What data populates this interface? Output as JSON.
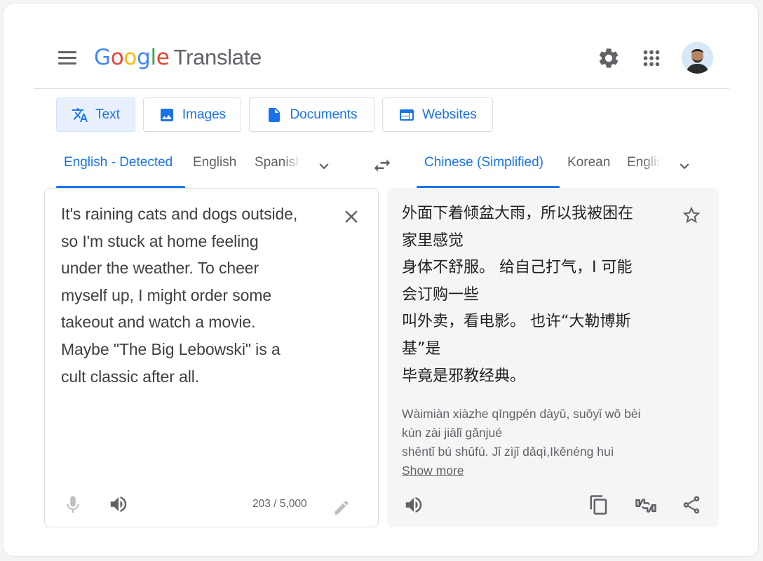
{
  "header": {
    "logo_brand": "Google",
    "logo_product": "Translate",
    "icons": [
      "menu-icon",
      "settings-gear-icon",
      "apps-grid-icon",
      "account-avatar"
    ]
  },
  "mode_tabs": [
    {
      "label": "Text",
      "icon": "translate-icon",
      "active": true
    },
    {
      "label": "Images",
      "icon": "image-icon",
      "active": false
    },
    {
      "label": "Documents",
      "icon": "document-icon",
      "active": false
    },
    {
      "label": "Websites",
      "icon": "website-icon",
      "active": false
    }
  ],
  "source_languages": {
    "selected": "English - Detected",
    "options": [
      "English - Detected",
      "English",
      "Spanish"
    ]
  },
  "target_languages": {
    "selected": "Chinese (Simplified)",
    "options": [
      "Chinese (Simplified)",
      "Korean",
      "English"
    ]
  },
  "source": {
    "lines": [
      "It's raining cats and dogs outside,",
      "so I'm stuck at home feeling",
      "under the weather. To cheer",
      "myself up, I might order some",
      "takeout and watch a movie.",
      "Maybe \"The Big Lebowski\" is a",
      "cult classic after all."
    ],
    "char_count": "203 / 5,000"
  },
  "translation": {
    "lines": [
      "外面下着倾盆大雨，所以我被困在",
      "家里感觉",
      "身体不舒服。 给自己打气，I 可能",
      "会订购一些",
      "叫外卖，看电影。 也许“大勒博斯",
      "基”是",
      "毕竟是邪教经典。"
    ],
    "romanization_lines": [
      "Wàimiàn xiàzhe qīngpén dàyǔ, suǒyǐ wǒ bèi",
      "kùn zài jiālǐ gǎnjué",
      "shēntǐ bú shūfú. Jǐ zìjǐ dǎqì,Ikěnéng huì"
    ],
    "show_more": "Show more"
  },
  "colors": {
    "accent_blue": "#1a73e8",
    "google_blue": "#4285f4",
    "google_red": "#ea4335",
    "google_yellow": "#fbbc05",
    "google_green": "#34a853",
    "icon_gray": "#5f6368",
    "panel_gray": "#f5f5f5"
  }
}
